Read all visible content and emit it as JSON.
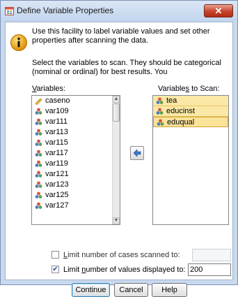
{
  "window": {
    "title": "Define Variable Properties",
    "close_glyph": "✕"
  },
  "info": {
    "icon": "info-icon",
    "text": "Use this facility to label variable values and set other properties after scanning the data."
  },
  "instructions": "Select the variables to scan. They should be categorical (nominal or ordinal) for best results. You",
  "variables_list": {
    "label_prefix": "",
    "label_hotkey": "V",
    "label_rest": "ariables:",
    "items": [
      {
        "name": "caseno",
        "icon": "ruler-icon"
      },
      {
        "name": "var109",
        "icon": "nominal-icon"
      },
      {
        "name": "var111",
        "icon": "nominal-icon"
      },
      {
        "name": "var113",
        "icon": "nominal-icon"
      },
      {
        "name": "var115",
        "icon": "nominal-icon"
      },
      {
        "name": "var117",
        "icon": "nominal-icon"
      },
      {
        "name": "var119",
        "icon": "nominal-icon"
      },
      {
        "name": "var121",
        "icon": "nominal-icon"
      },
      {
        "name": "var123",
        "icon": "nominal-icon"
      },
      {
        "name": "var125",
        "icon": "nominal-icon"
      },
      {
        "name": "var127",
        "icon": "nominal-icon"
      }
    ]
  },
  "scan_list": {
    "label_prefix": "Variable",
    "label_hotkey": "s",
    "label_rest": " to Scan:",
    "items": [
      {
        "name": "tea",
        "icon": "nominal-icon"
      },
      {
        "name": "educinst",
        "icon": "nominal-icon"
      },
      {
        "name": "eduqual",
        "icon": "nominal-icon"
      }
    ]
  },
  "move_button": {
    "icon": "arrow-left-icon"
  },
  "options": {
    "limit_cases": {
      "checked": false,
      "hotkey": "L",
      "label_rest": "imit number of cases scanned to:",
      "value": ""
    },
    "limit_values": {
      "checked": true,
      "prefix": "Limit ",
      "hotkey": "n",
      "label_rest": "umber of values displayed to:",
      "value": "200"
    }
  },
  "buttons": {
    "continue": "Continue",
    "cancel": "Cancel",
    "help": "Help"
  },
  "colors": {
    "title_bg": "#c9d9ee",
    "close_red": "#c7432b",
    "selected_fill": "#fbe8a6"
  }
}
